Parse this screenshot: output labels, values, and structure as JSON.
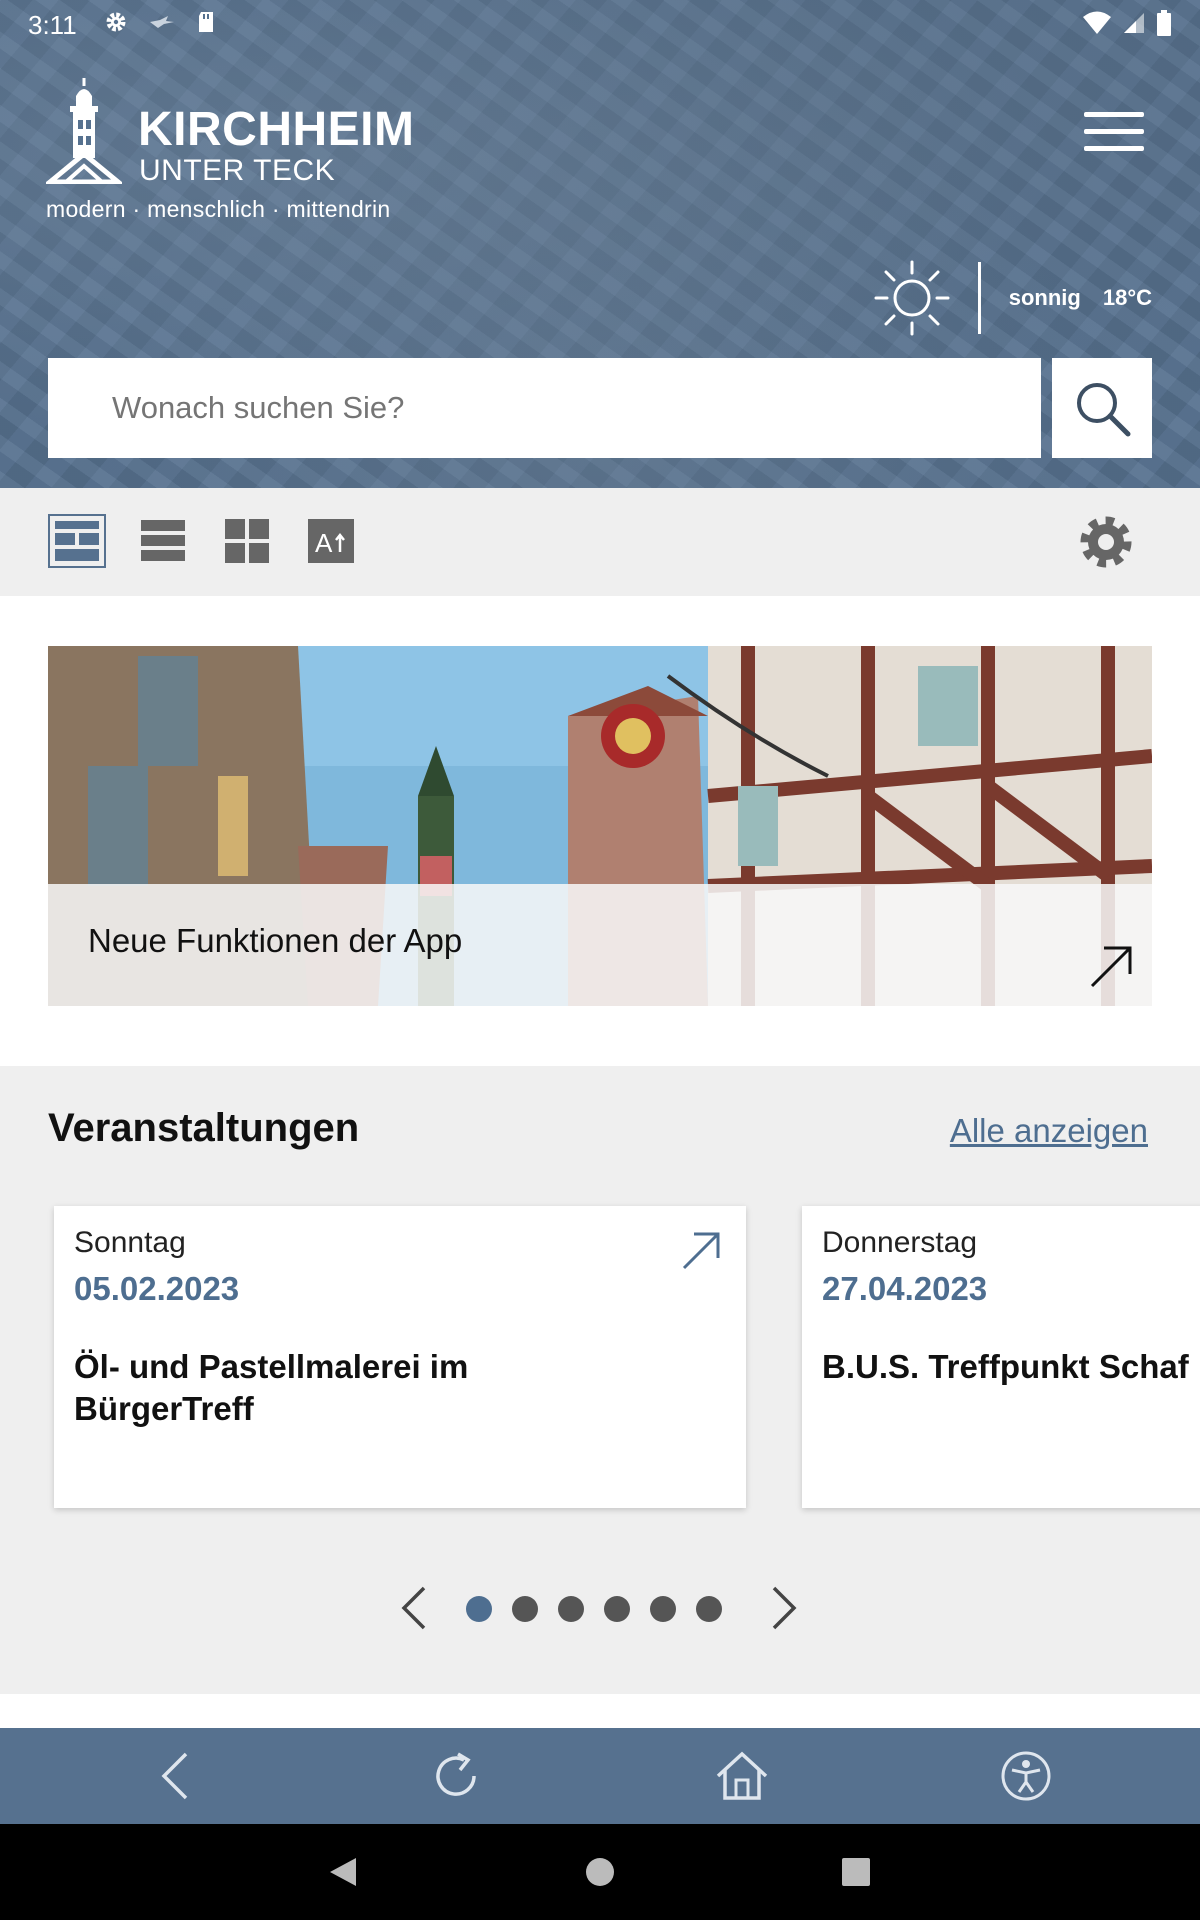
{
  "status_bar": {
    "time": "3:11",
    "left_icons": [
      "gear-icon",
      "bird-icon",
      "sd-card-icon"
    ],
    "right_icons": [
      "wifi-icon",
      "signal-icon",
      "battery-icon"
    ]
  },
  "header": {
    "logo_title": "KIRCHHEIM",
    "logo_subtitle": "UNTER TECK",
    "logo_tagline": "modern · menschlich · mittendrin",
    "menu_icon": "hamburger-icon",
    "weather": {
      "icon": "sun-icon",
      "condition": "sonnig",
      "temperature": "18°C"
    },
    "search": {
      "placeholder": "Wonach suchen Sie?",
      "icon": "search-icon"
    },
    "colors": {
      "header_bg": "#56718f",
      "accent": "#4e6e90"
    }
  },
  "toolbar": {
    "views": [
      {
        "icon": "layout-tiles-icon",
        "active": true
      },
      {
        "icon": "layout-list-icon",
        "active": false
      },
      {
        "icon": "layout-grid-icon",
        "active": false
      },
      {
        "icon": "font-size-icon",
        "active": false
      }
    ],
    "settings_icon": "gear-icon"
  },
  "banner": {
    "title": "Neue Funktionen der App",
    "icon": "external-arrow-icon"
  },
  "events": {
    "heading": "Veranstaltungen",
    "show_all": "Alle anzeigen",
    "cards": [
      {
        "weekday": "Sonntag",
        "date": "05.02.2023",
        "title": "Öl- und Pastellmalerei im\nBürgerTreff"
      },
      {
        "weekday": "Donnerstag",
        "date": "27.04.2023",
        "title": "B.U.S. Treffpunkt Schaf"
      }
    ],
    "pager": {
      "pages": 6,
      "current": 1
    }
  },
  "app_nav": {
    "items": [
      "back-icon",
      "reload-icon",
      "home-icon",
      "accessibility-icon"
    ]
  },
  "system_nav": {
    "items": [
      "back-triangle-icon",
      "home-circle-icon",
      "recents-square-icon"
    ]
  }
}
